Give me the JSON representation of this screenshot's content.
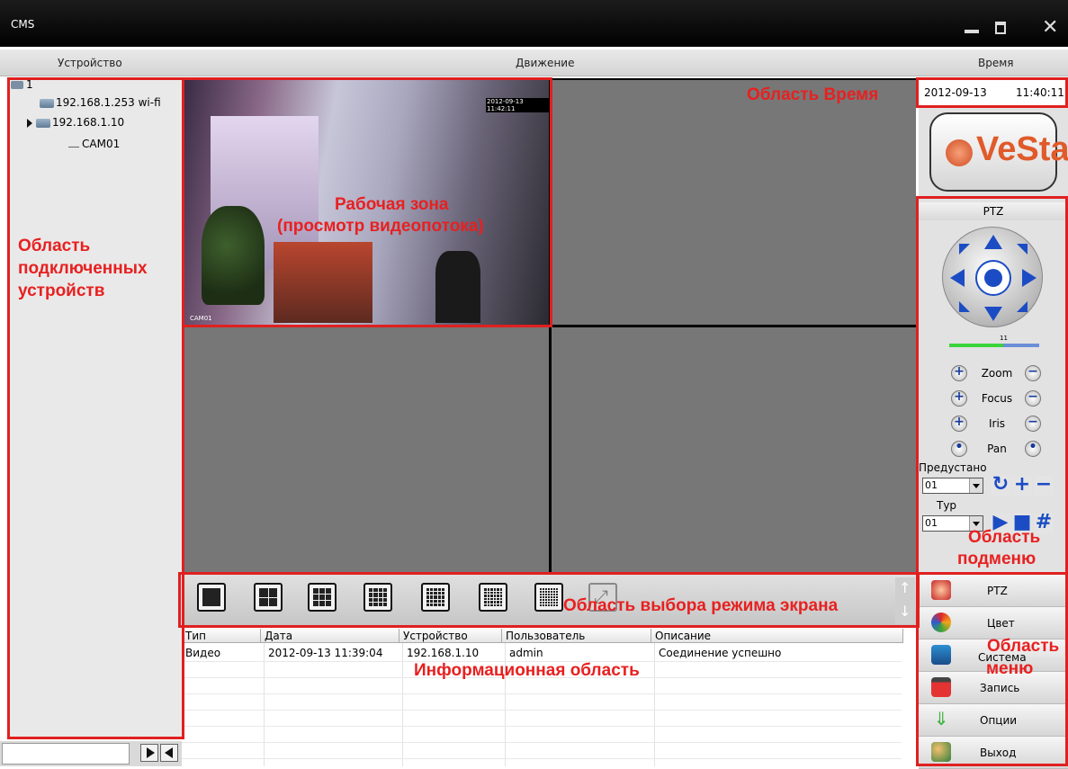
{
  "window": {
    "title": "CMS"
  },
  "menubar": {
    "device": "Устройство",
    "motion": "Движение",
    "time": "Время"
  },
  "device_tree": {
    "root": "1",
    "items": [
      {
        "label": "192.168.1.253 wi-fi"
      },
      {
        "label": "192.168.1.10"
      },
      {
        "label": "CAM01"
      }
    ]
  },
  "video": {
    "timestamp": "2012-09-13 11:42:11",
    "camera_label": "CAM01"
  },
  "datetime": {
    "date": "2012-09-13",
    "time": "11:40:11"
  },
  "logo": {
    "text": "VeSta"
  },
  "ptz": {
    "title": "PTZ",
    "speed_value": "11",
    "controls": [
      "Zoom",
      "Focus",
      "Iris",
      "Pan"
    ],
    "preset_label": "Предустано",
    "preset_value": "01",
    "tour_label": "Тур",
    "tour_value": "01"
  },
  "menu": {
    "items": [
      {
        "label": "PTZ"
      },
      {
        "label": "Цвет"
      },
      {
        "label": "Система"
      },
      {
        "label": "Запись"
      },
      {
        "label": "Опции"
      },
      {
        "label": "Выход"
      }
    ]
  },
  "table": {
    "columns": [
      "Тип",
      "Дата",
      "Устройство",
      "Пользователь",
      "Описание"
    ],
    "rows": [
      [
        "Видео",
        "2012-09-13 11:39:04",
        "192.168.1.10",
        "admin",
        "Соединение успешно"
      ]
    ]
  },
  "annotations": {
    "time_area": "Область Время",
    "work_zone_1": "Рабочая зона",
    "work_zone_2": "(просмотр видеопотока)",
    "devices_1": "Область",
    "devices_2": "подключенных",
    "devices_3": "устройств",
    "submenu_1": "Область",
    "submenu_2": "подменю",
    "screen_mode": "Область выбора режима экрана",
    "menu_1": "Область",
    "menu_2": "меню",
    "info_area": "Информационная область"
  },
  "colors": {
    "annotation_red": "#e02020",
    "accent_blue": "#1c4cc4"
  }
}
